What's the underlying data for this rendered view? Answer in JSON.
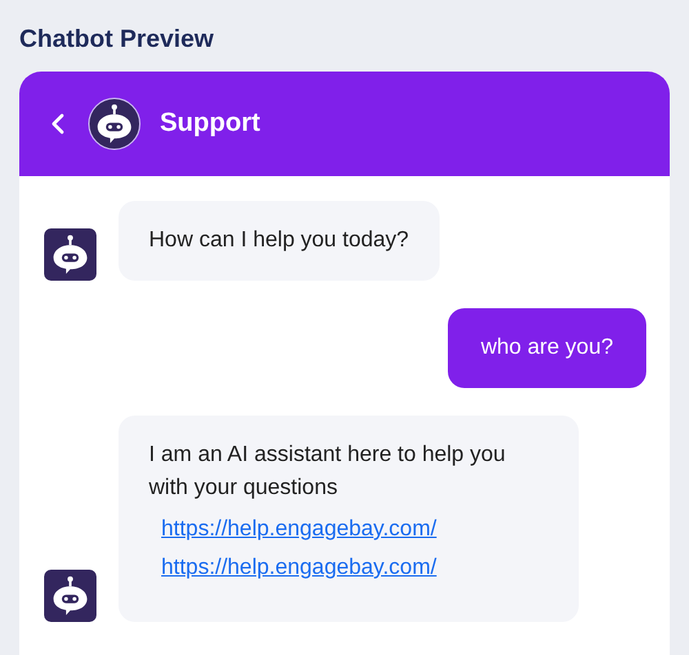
{
  "title": "Chatbot Preview",
  "header": {
    "name": "Support"
  },
  "messages": [
    {
      "kind": "bot",
      "text": "How can I help you today?"
    },
    {
      "kind": "user",
      "text": "who are you?"
    },
    {
      "kind": "bot",
      "text": "I am an AI assistant here to help you with your questions",
      "links": [
        "https://help.engagebay.com/",
        "https://help.engagebay.com/"
      ]
    }
  ]
}
